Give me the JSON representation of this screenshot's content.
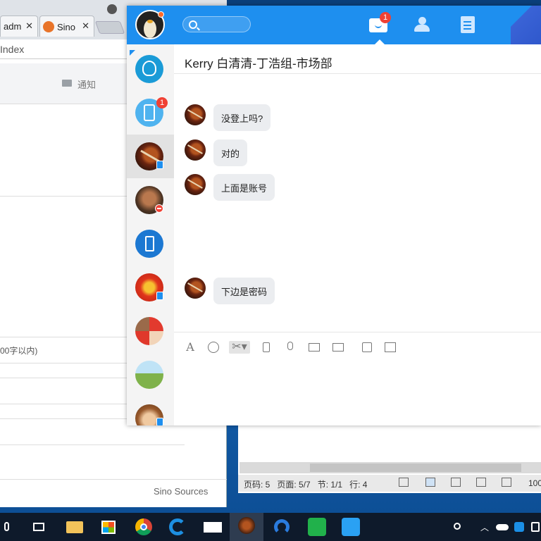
{
  "browser": {
    "tabs": [
      {
        "label": "adm"
      },
      {
        "label": "Sino"
      }
    ],
    "tab_close": "✕",
    "address_text": "Index",
    "nav_notice": "通知",
    "input_hint": "00字以内)",
    "footer_text": "Sino Sources"
  },
  "word_status": {
    "page_code": "页码: 5",
    "page": "页面: 5/7",
    "section": "节: 1/1",
    "line": "行: 4",
    "zoom": "100"
  },
  "chat": {
    "header": {
      "search_placeholder": "",
      "message_badge": "1"
    },
    "sidebar": {
      "notification_badge": "1"
    },
    "title": "Kerry 白清清-丁浩组-市场部",
    "messages": [
      {
        "text": "没登上吗?"
      },
      {
        "text": "对的"
      },
      {
        "text": "上面是账号"
      },
      {
        "text": "下边是密码"
      }
    ],
    "toolbar_font": "A",
    "colors": {
      "header_blue": "#1e8fef",
      "badge_red": "#f04134",
      "bubble_gray": "#ebedf0"
    }
  }
}
